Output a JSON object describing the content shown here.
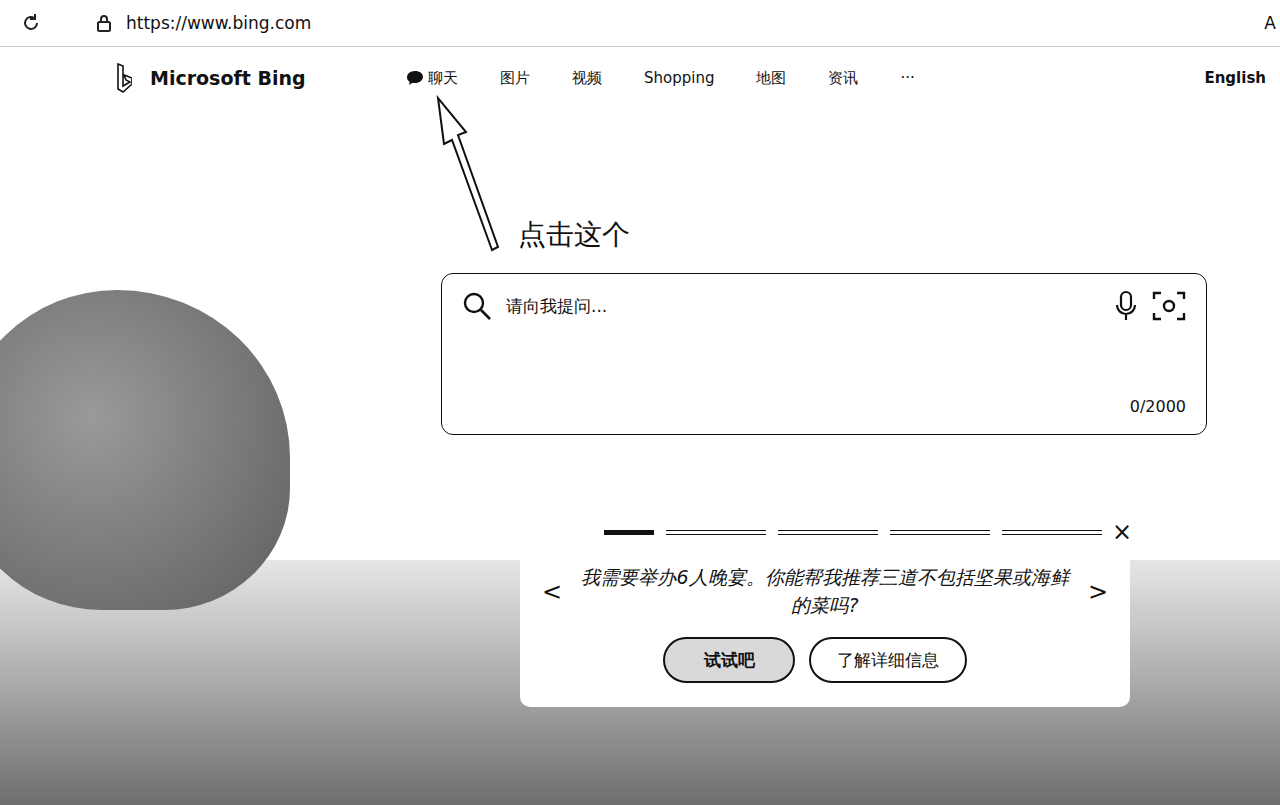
{
  "browser": {
    "url": "https://www.bing.com",
    "edge_text": "A"
  },
  "header": {
    "logo": "Microsoft Bing",
    "nav": [
      {
        "label": "聊天",
        "selected": false
      },
      {
        "label": "图片",
        "selected": false
      },
      {
        "label": "视频",
        "selected": false
      },
      {
        "label": "Shopping",
        "selected": false
      },
      {
        "label": "地图",
        "selected": false
      },
      {
        "label": "资讯",
        "selected": false
      },
      {
        "label": "···",
        "selected": false
      }
    ],
    "language": "English"
  },
  "annotation": {
    "text": "点击这个"
  },
  "search": {
    "placeholder": "请向我提问...",
    "counter": "0/2000"
  },
  "carousel": {
    "steps": [
      {
        "selected": true
      },
      {
        "selected": false
      },
      {
        "selected": false
      },
      {
        "selected": false
      },
      {
        "selected": false
      }
    ],
    "close": "×",
    "prev": "<",
    "next": ">",
    "prompt": "我需要举办6人晚宴。你能帮我推荐三道不包括坚果或海鲜的菜吗?",
    "buttons": [
      "试试吧",
      "了解详细信息"
    ]
  }
}
